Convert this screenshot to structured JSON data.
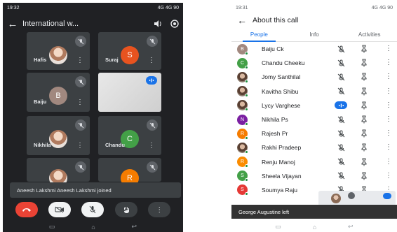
{
  "left": {
    "status": {
      "time": "19:32",
      "right": "4G 4G 90"
    },
    "title": "International w...",
    "tiles": [
      {
        "name": "Hafis",
        "avatar_type": "photo"
      },
      {
        "name": "Suraj",
        "initial": "S",
        "color": "#e8531f"
      },
      {
        "name": "Baiju",
        "initial": "B",
        "color": "#a1887f"
      },
      {
        "name": "",
        "avatar_type": "video"
      },
      {
        "name": "Nikhila",
        "avatar_type": "photo"
      },
      {
        "name": "Chandu",
        "initial": "C",
        "color": "#43a047"
      },
      {
        "name": "",
        "avatar_type": "photo"
      },
      {
        "name": "",
        "initial": "R",
        "color": "#f57c00"
      }
    ],
    "toast": "Aneesh Lakshmi Aneesh Lakshmi joined",
    "controls": [
      "end-call",
      "camera-off",
      "mic-off",
      "raise-hand",
      "more"
    ]
  },
  "right": {
    "status": {
      "time": "19:31",
      "right": "4G 4G 90"
    },
    "title": "About this call",
    "tabs": [
      "People",
      "Info",
      "Activities"
    ],
    "people": [
      {
        "name": "Baiju Ck",
        "initial": "B",
        "color": "#a1887f",
        "speaking": false
      },
      {
        "name": "Chandu Cheeku",
        "initial": "C",
        "color": "#43a047",
        "speaking": false
      },
      {
        "name": "Jomy Santhilal",
        "avatar_type": "photo",
        "speaking": false
      },
      {
        "name": "Kavitha Shibu",
        "avatar_type": "photo",
        "speaking": false
      },
      {
        "name": "Lycy Varghese",
        "avatar_type": "photo",
        "speaking": true
      },
      {
        "name": "Nikhila Ps",
        "initial": "N",
        "color": "#7b1fa2",
        "speaking": false
      },
      {
        "name": "Rajesh Pr",
        "initial": "R",
        "color": "#f57c00",
        "speaking": false
      },
      {
        "name": "Rakhi Pradeep",
        "avatar_type": "photo",
        "speaking": false
      },
      {
        "name": "Renju Manoj",
        "initial": "R",
        "color": "#fb8c00",
        "speaking": false
      },
      {
        "name": "Sheela Vijayan",
        "initial": "S",
        "color": "#43a047",
        "speaking": false
      },
      {
        "name": "Soumya Raju",
        "initial": "S",
        "color": "#e53935",
        "speaking": false
      }
    ],
    "toast": "George Augustine left"
  }
}
